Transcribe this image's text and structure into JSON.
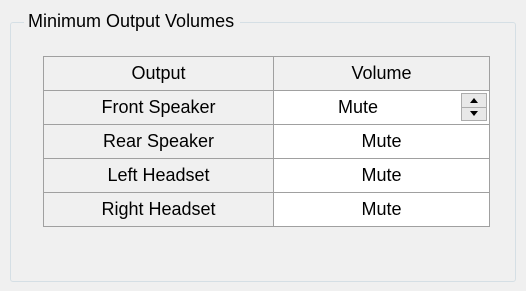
{
  "group": {
    "title": "Minimum Output Volumes"
  },
  "table": {
    "headers": [
      "Output",
      "Volume"
    ],
    "rows": [
      {
        "output": "Front Speaker",
        "volume": "Mute",
        "editing": true
      },
      {
        "output": "Rear Speaker",
        "volume": "Mute"
      },
      {
        "output": "Left Headset",
        "volume": "Mute"
      },
      {
        "output": "Right Headset",
        "volume": "Mute"
      }
    ]
  },
  "icons": {
    "spin_up": "spin-up-arrow-icon",
    "spin_down": "spin-down-arrow-icon"
  }
}
